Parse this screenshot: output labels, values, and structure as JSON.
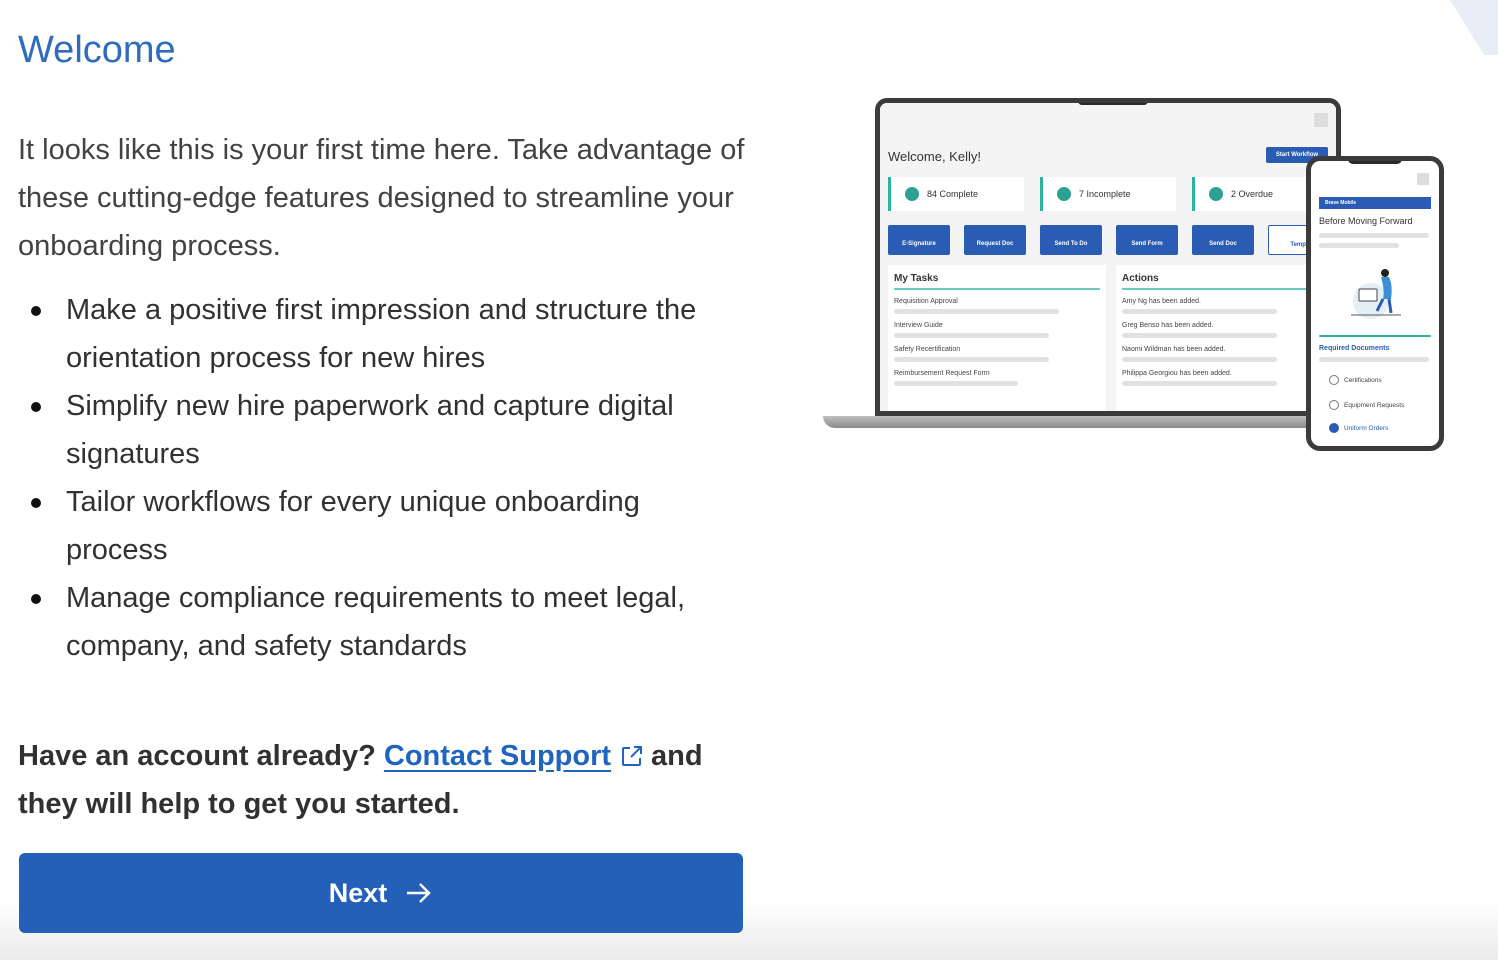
{
  "title": "Welcome",
  "intro": "It looks like this is your first time here. Take advantage of these cutting-edge features designed to streamline your onboarding process.",
  "features": [
    "Make a positive first impression and structure the orientation process for new hires",
    "Simplify new hire paperwork and capture digital signatures",
    "Tailor workflows for every unique onboarding process",
    "Manage compliance requirements to meet legal, company, and safety standards"
  ],
  "account": {
    "prefix": "Have an account already?",
    "link_label": "Contact Support",
    "suffix": "and they will help to get you started."
  },
  "next_label": "Next",
  "illustration": {
    "welcome": "Welcome, Kelly!",
    "start_workflow": "Start Workflow",
    "stats": [
      "84 Complete",
      "7 Incomplete",
      "2 Overdue"
    ],
    "quick_actions": [
      "E-Signature",
      "Request Doc",
      "Send To Do",
      "Send Form",
      "Send Doc",
      "Templ"
    ],
    "my_tasks_title": "My Tasks",
    "my_tasks": [
      "Requisition Approval",
      "Interview Guide",
      "Safety Recertification",
      "Reimbursement Request Form"
    ],
    "actions_title": "Actions",
    "actions": [
      "Amy Ng has been added.",
      "Greg Benso has been added.",
      "Naomi Wildman has been added.",
      "Philippa Georgiou has been added."
    ],
    "phone_header": "Brave Mobile",
    "phone_title": "Before Moving Forward",
    "phone_required": "Required Documents",
    "phone_items": [
      "Certifications",
      "Equipment Requests",
      "Uniform Orders"
    ]
  },
  "colors": {
    "title": "#2f6cbd",
    "link": "#1f64c0",
    "button": "#2560b8",
    "accent_teal": "#2bb3a2"
  }
}
